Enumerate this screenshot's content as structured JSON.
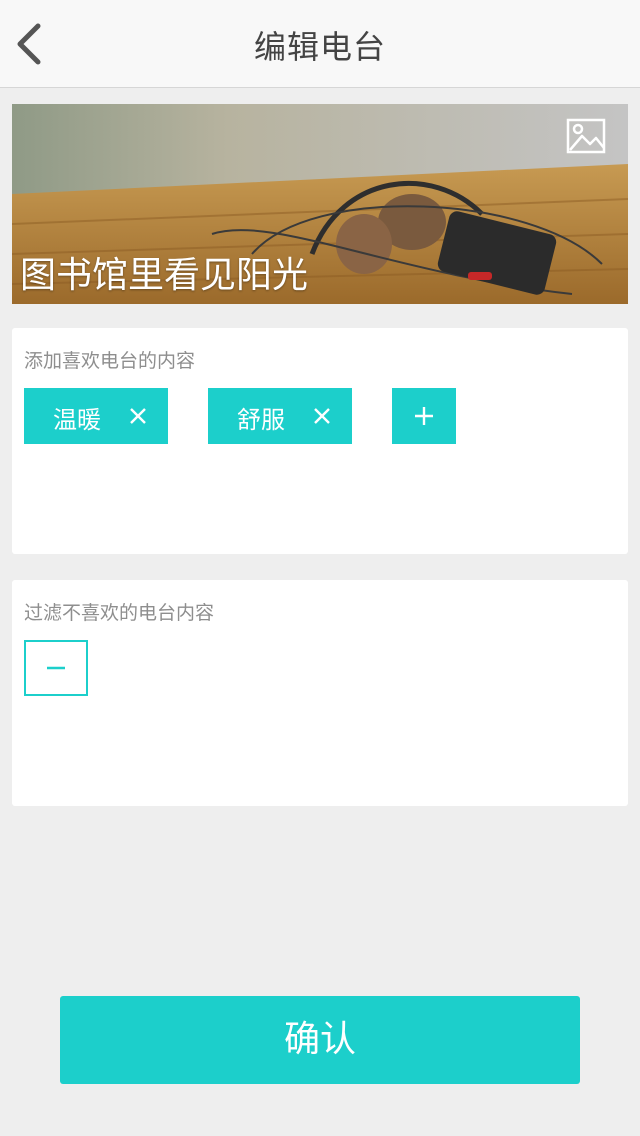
{
  "nav": {
    "title": "编辑电台",
    "back_icon": "chevron-left-icon"
  },
  "banner": {
    "caption": "图书馆里看见阳光",
    "image_icon": "image-icon"
  },
  "like_section": {
    "label": "添加喜欢电台的内容",
    "tags": [
      {
        "text": "温暖"
      },
      {
        "text": "舒服"
      }
    ],
    "add_icon": "plus-icon"
  },
  "dislike_section": {
    "label": "过滤不喜欢的电台内容",
    "minus_icon": "minus-icon"
  },
  "confirm_label": "确认",
  "colors": {
    "accent": "#1ccfcb",
    "background": "#eeeeee",
    "card": "#ffffff"
  }
}
